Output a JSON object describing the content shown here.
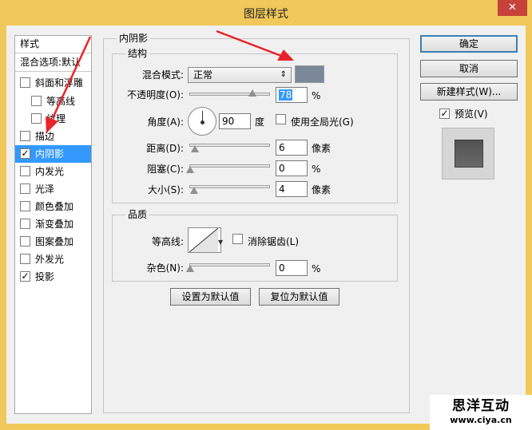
{
  "window": {
    "title": "图层样式",
    "close_symbol": "✕"
  },
  "styles_panel": {
    "header": "样式",
    "blend_options": "混合选项:默认",
    "items": [
      {
        "label": "斜面和浮雕",
        "checked": false
      },
      {
        "label": "等高线",
        "checked": false
      },
      {
        "label": "纹理",
        "checked": false
      },
      {
        "label": "描边",
        "checked": false
      },
      {
        "label": "内阴影",
        "checked": true,
        "selected": true
      },
      {
        "label": "内发光",
        "checked": false
      },
      {
        "label": "光泽",
        "checked": false
      },
      {
        "label": "颜色叠加",
        "checked": false
      },
      {
        "label": "渐变叠加",
        "checked": false
      },
      {
        "label": "图案叠加",
        "checked": false
      },
      {
        "label": "外发光",
        "checked": false
      },
      {
        "label": "投影",
        "checked": true
      }
    ]
  },
  "inner_shadow": {
    "section_title": "内阴影",
    "structure_title": "结构",
    "blend_mode_label": "混合模式:",
    "blend_mode_value": "正常",
    "color": "#7a8899",
    "opacity_label": "不透明度(O):",
    "opacity_value": "78",
    "opacity_unit": "%",
    "opacity_level": 78,
    "angle_label": "角度(A):",
    "angle_value": "90",
    "angle_unit": "度",
    "global_light_label": "使用全局光(G)",
    "distance_label": "距离(D):",
    "distance_value": "6",
    "distance_unit": "像素",
    "choke_label": "阻塞(C):",
    "choke_value": "0",
    "choke_unit": "%",
    "size_label": "大小(S):",
    "size_value": "4",
    "size_unit": "像素"
  },
  "quality": {
    "title": "品质",
    "contour_label": "等高线:",
    "anti_alias_label": "消除锯齿(L)",
    "noise_label": "杂色(N):",
    "noise_value": "0",
    "noise_unit": "%"
  },
  "default_buttons": {
    "set_default": "设置为默认值",
    "reset_default": "复位为默认值"
  },
  "actions": {
    "ok": "确定",
    "cancel": "取消",
    "new_style": "新建样式(W)...",
    "preview_label": "预览(V)",
    "preview_checked": true
  },
  "watermark": {
    "line1": "思洋互动",
    "line2": "www.ciya.cn"
  },
  "colors": {
    "annotation_arrow": "#e8232a",
    "selection": "#3399ff",
    "title_bar": "#f0c95a"
  }
}
